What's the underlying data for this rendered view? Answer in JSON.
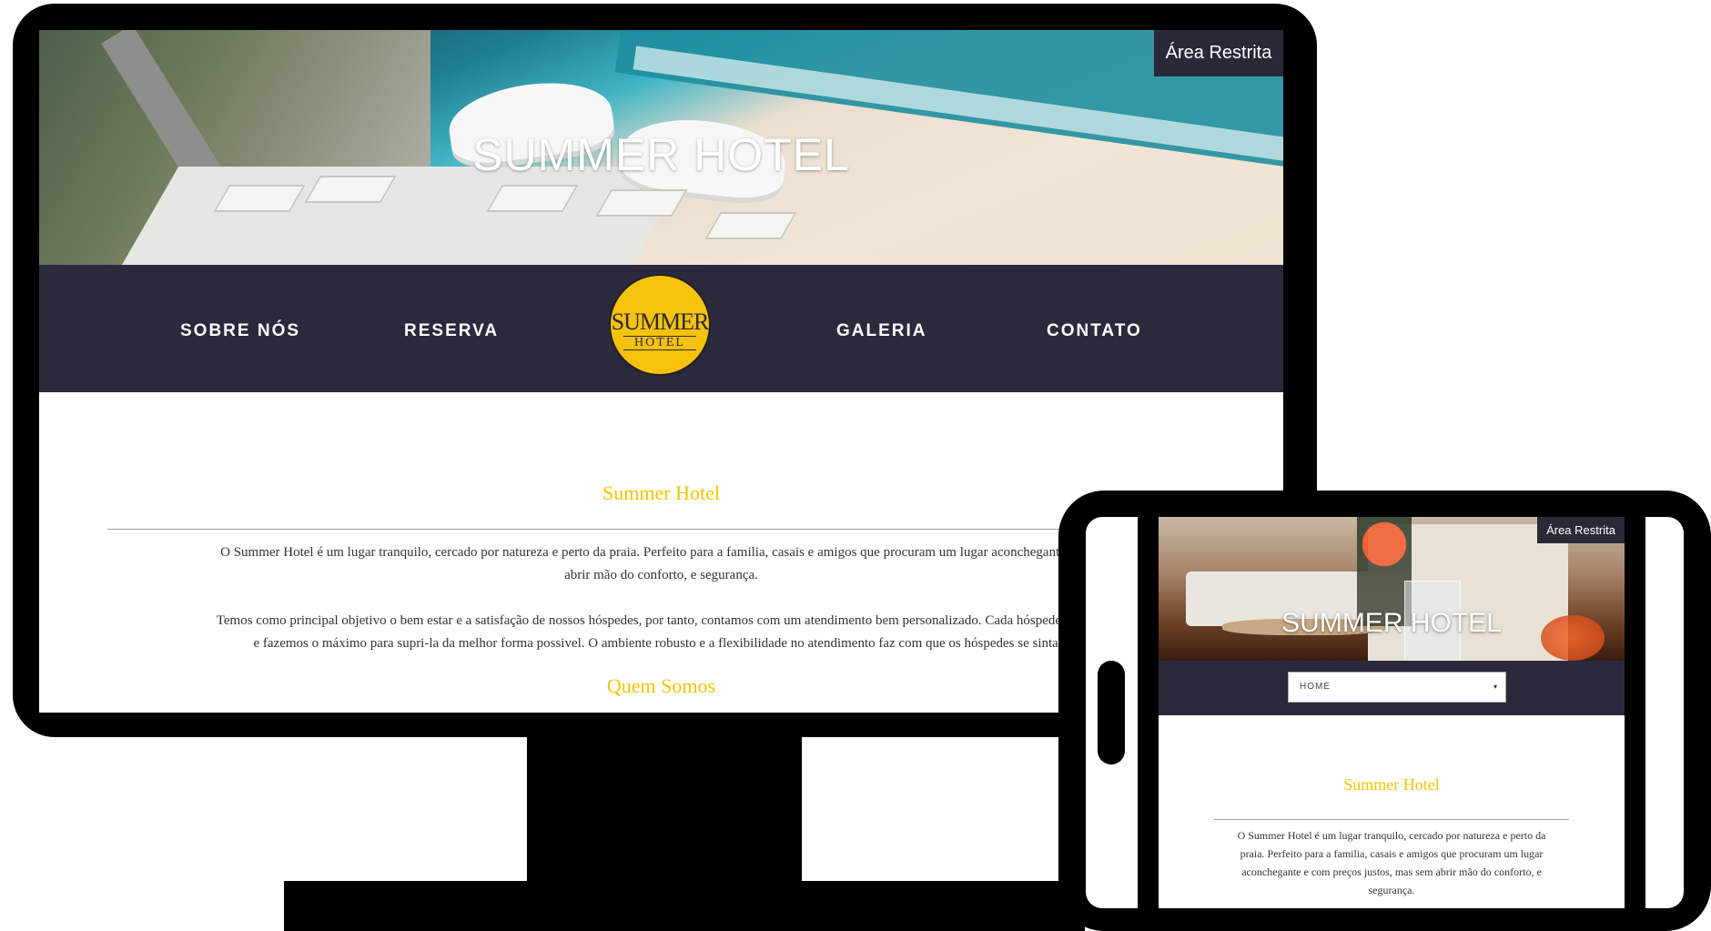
{
  "desktop": {
    "hero": {
      "title": "SUMMER HOTEL",
      "restricted_label": "Área Restrita"
    },
    "nav": {
      "items": [
        "SOBRE NÓS",
        "RESERVA",
        "GALERIA",
        "CONTATO"
      ]
    },
    "logo": {
      "line1": "SUMMER",
      "line2": "HOTEL"
    },
    "content": {
      "heading": "Summer Hotel",
      "paragraph1_line1": "O Summer Hotel é um lugar tranquilo, cercado por natureza e perto da praia.  Perfeito para a familia, casais e amigos que procuram um lugar aconchegante e com",
      "paragraph1_line2": "abrir mão do conforto, e segurança.",
      "paragraph2_line1": "Temos como principal objetivo o bem estar e a satisfação de nossos hóspedes, por tanto, contamos com um atendimento bem personalizado. Cada hóspede tem um",
      "paragraph2_line2": "e fazemos o máximo para supri-la da melhor forma possivel. O ambiente robusto e a flexibilidade no atendimento faz com que os hóspedes se sintam",
      "subheading": "Quem Somos"
    }
  },
  "tablet": {
    "hero": {
      "title": "SUMMER HOTEL",
      "restricted_label": "Área Restrita"
    },
    "nav": {
      "select_value": "HOME",
      "caret": "▾"
    },
    "content": {
      "heading": "Summer Hotel",
      "line1": "O Summer Hotel é um lugar tranquilo, cercado por natureza e perto da",
      "line2": "praia.  Perfeito para a familia, casais e amigos que procuram um lugar",
      "line3": "aconchegante e com preços justos, mas sem abrir mão do conforto, e",
      "line4": "segurança."
    }
  },
  "colors": {
    "nav_bg": "#2b2a3d",
    "accent_yellow": "#f5c300",
    "logo_yellow": "#f7c20c"
  }
}
